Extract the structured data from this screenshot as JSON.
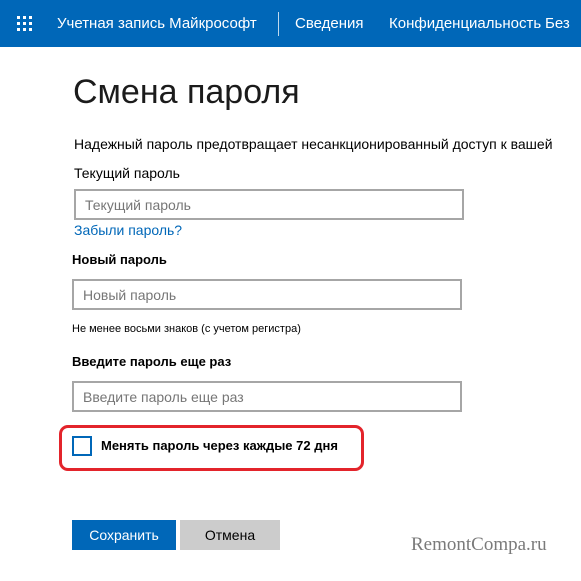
{
  "header": {
    "app_title": "Учетная запись Майкрософт",
    "nav": [
      {
        "label": "Сведения"
      },
      {
        "label": "Конфиденциальность"
      },
      {
        "label": "Без"
      }
    ]
  },
  "main": {
    "title": "Смена пароля",
    "intro": "Надежный пароль предотвращает несанкционированный доступ к вашей",
    "current_password": {
      "label": "Текущий пароль",
      "placeholder": "Текущий пароль",
      "value": ""
    },
    "forgot_link": "Забыли пароль?",
    "new_password": {
      "label": "Новый пароль",
      "placeholder": "Новый пароль",
      "value": "",
      "hint": "Не менее восьми знаков (с учетом регистра)"
    },
    "repeat_password": {
      "label": "Введите пароль еще раз",
      "placeholder": "Введите пароль еще раз",
      "value": ""
    },
    "change_every": {
      "label": "Менять пароль через каждые 72 дня",
      "checked": false
    },
    "save_label": "Сохранить",
    "cancel_label": "Отмена"
  },
  "watermark": "RemontCompa.ru",
  "colors": {
    "brand": "#0067b8",
    "highlight": "#e3242b",
    "cancel_bg": "#cccccc"
  },
  "icons": {
    "app_launcher": "waffle-icon",
    "checkbox": "checkbox-unchecked-icon"
  }
}
